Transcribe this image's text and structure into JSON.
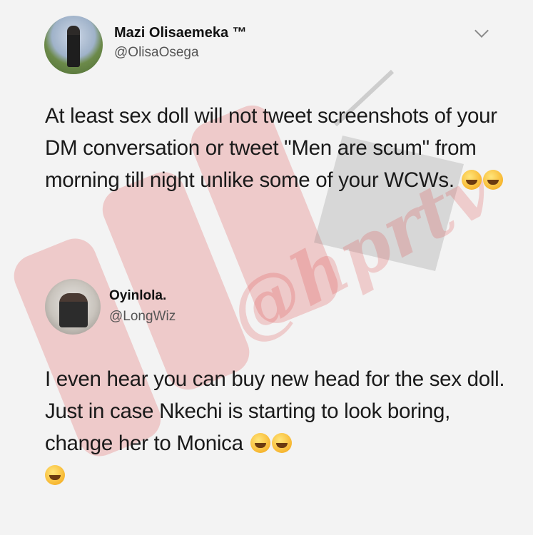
{
  "tweets": [
    {
      "display_name": "Mazi Olisaemeka ™",
      "handle": "@OlisaOsega",
      "text": "At least sex doll will not tweet screenshots of your DM conversation or tweet \"Men are scum\" from morning till night unlike some of your WCWs.",
      "emojis": [
        "face-with-tears-of-joy",
        "face-with-tears-of-joy"
      ]
    },
    {
      "display_name": "Oyinlola.",
      "handle": "@LongWiz",
      "text": "I even hear you can buy new head for the sex doll. Just in case Nkechi is starting to look boring, change her to Monica",
      "emojis": [
        "grinning-face",
        "grinning-face",
        "grinning-face"
      ]
    }
  ],
  "watermark": {
    "logo_text": "HPRtv",
    "handle": "@hprtv",
    "color": "#e34848"
  },
  "icons": {
    "menu": "chevron-down-icon"
  }
}
